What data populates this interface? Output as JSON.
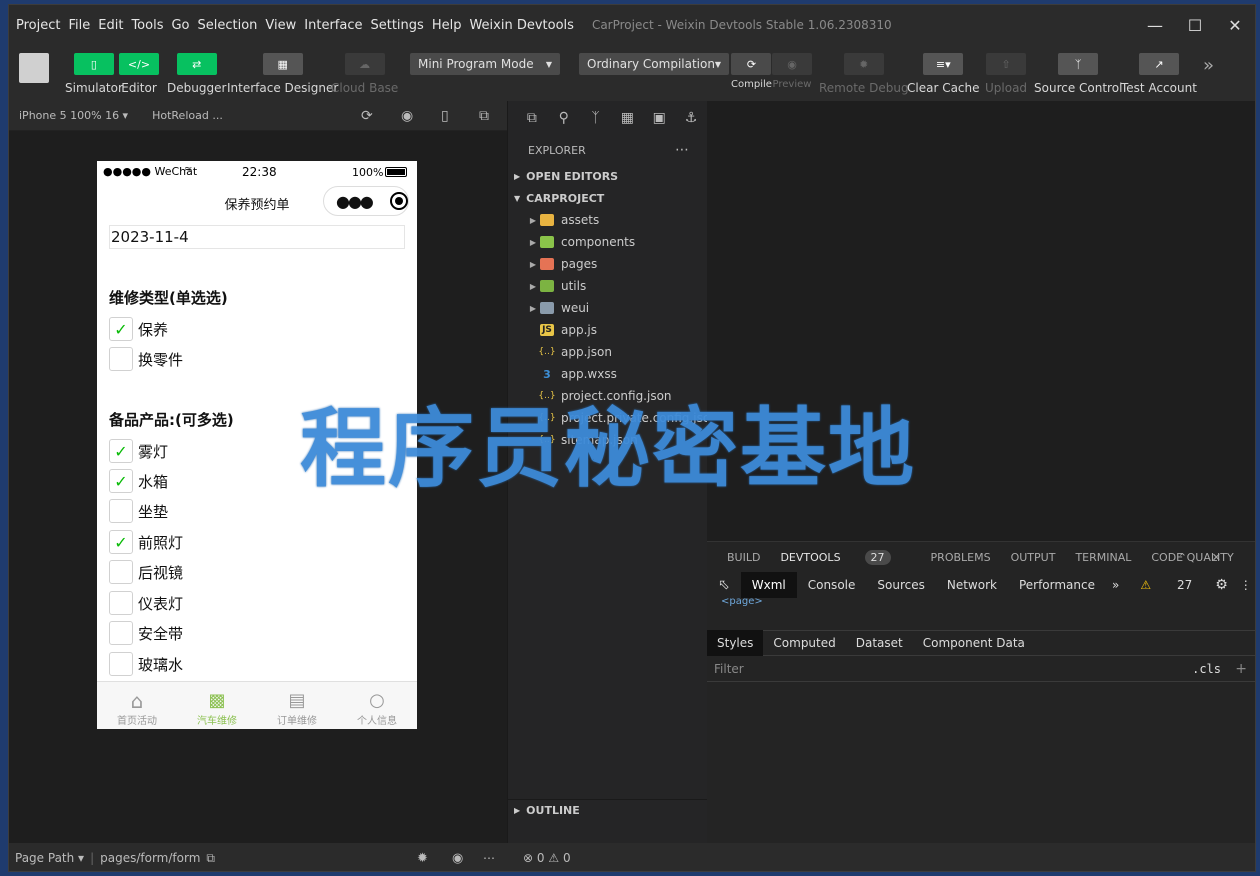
{
  "menu": [
    "Project",
    "File",
    "Edit",
    "Tools",
    "Go",
    "Selection",
    "View",
    "Interface",
    "Settings",
    "Help",
    "Weixin Devtools"
  ],
  "window_title": "CarProject - Weixin Devtools Stable 1.06.2308310",
  "toolbar": {
    "simulator": "Simulator",
    "editor": "Editor",
    "debugger": "Debugger",
    "interface_designer": "Interface Designer",
    "cloud_base": "Cloud Base",
    "mode": "Mini Program Mode",
    "compilation": "Ordinary Compilation",
    "compile": "Compile",
    "preview": "Preview",
    "remote_debug": "Remote Debug",
    "clear_cache": "Clear Cache",
    "upload": "Upload",
    "source_control": "Source Control",
    "test_account": "Test Account"
  },
  "simbar": {
    "device": "iPhone 5 100% 16 ▾",
    "hotreload": "HotReload ..."
  },
  "phone": {
    "carrier": "●●●●● WeChat",
    "time": "22:38",
    "battery": "100%",
    "nav_title": "保养预约单",
    "date": "2023-11-4",
    "section1": "维修类型(单选选)",
    "section1_items": [
      {
        "label": "保养",
        "checked": true
      },
      {
        "label": "换零件",
        "checked": false
      }
    ],
    "section2": "备品产品:(可多选)",
    "section2_items": [
      {
        "label": "雾灯",
        "checked": true
      },
      {
        "label": "水箱",
        "checked": true
      },
      {
        "label": "坐垫",
        "checked": false
      },
      {
        "label": "前照灯",
        "checked": true
      },
      {
        "label": "后视镜",
        "checked": false
      },
      {
        "label": "仪表灯",
        "checked": false
      },
      {
        "label": "安全带",
        "checked": false
      },
      {
        "label": "玻璃水",
        "checked": false
      }
    ],
    "tabs": [
      {
        "label": "首页活动",
        "active": false
      },
      {
        "label": "汽车维修",
        "active": true
      },
      {
        "label": "订单维修",
        "active": false
      },
      {
        "label": "个人信息",
        "active": false
      }
    ]
  },
  "explorer": {
    "title": "EXPLORER",
    "open_editors": "OPEN EDITORS",
    "project": "CARPROJECT",
    "folders": [
      {
        "name": "assets",
        "color": "#e8b341"
      },
      {
        "name": "components",
        "color": "#8bc34a"
      },
      {
        "name": "pages",
        "color": "#e57355"
      },
      {
        "name": "utils",
        "color": "#7cb342"
      },
      {
        "name": "weui",
        "color": "#8a9bab"
      }
    ],
    "files": [
      {
        "name": "app.js",
        "icon": "JS",
        "color": "#e8c547"
      },
      {
        "name": "app.json",
        "icon": "{..}",
        "color": "#e8c547"
      },
      {
        "name": "app.wxss",
        "icon": "3",
        "color": "#3d8fd6"
      },
      {
        "name": "project.config.json",
        "icon": "{..}",
        "color": "#e8c547"
      },
      {
        "name": "project.private.config.json",
        "icon": "{..}",
        "color": "#e8c547"
      },
      {
        "name": "sitemap.json",
        "icon": "{..}",
        "color": "#e8c547"
      }
    ],
    "outline": "OUTLINE"
  },
  "panel": {
    "tabs": [
      "BUILD",
      "DEVTOOLS",
      "PROBLEMS",
      "OUTPUT",
      "TERMINAL",
      "CODE QUALITY"
    ],
    "devtools_count": "27",
    "devtools_tabs": [
      "Wxml",
      "Console",
      "Sources",
      "Network",
      "Performance"
    ],
    "warnings": "27",
    "wxml_line": "<page>",
    "style_tabs": [
      "Styles",
      "Computed",
      "Dataset",
      "Component Data"
    ],
    "filter_placeholder": "Filter",
    "cls": ".cls"
  },
  "status": {
    "page_path_label": "Page Path ▾",
    "page_path": "pages/form/form",
    "errors": "0",
    "warnings": "0"
  },
  "watermark": "程序员秘密基地"
}
